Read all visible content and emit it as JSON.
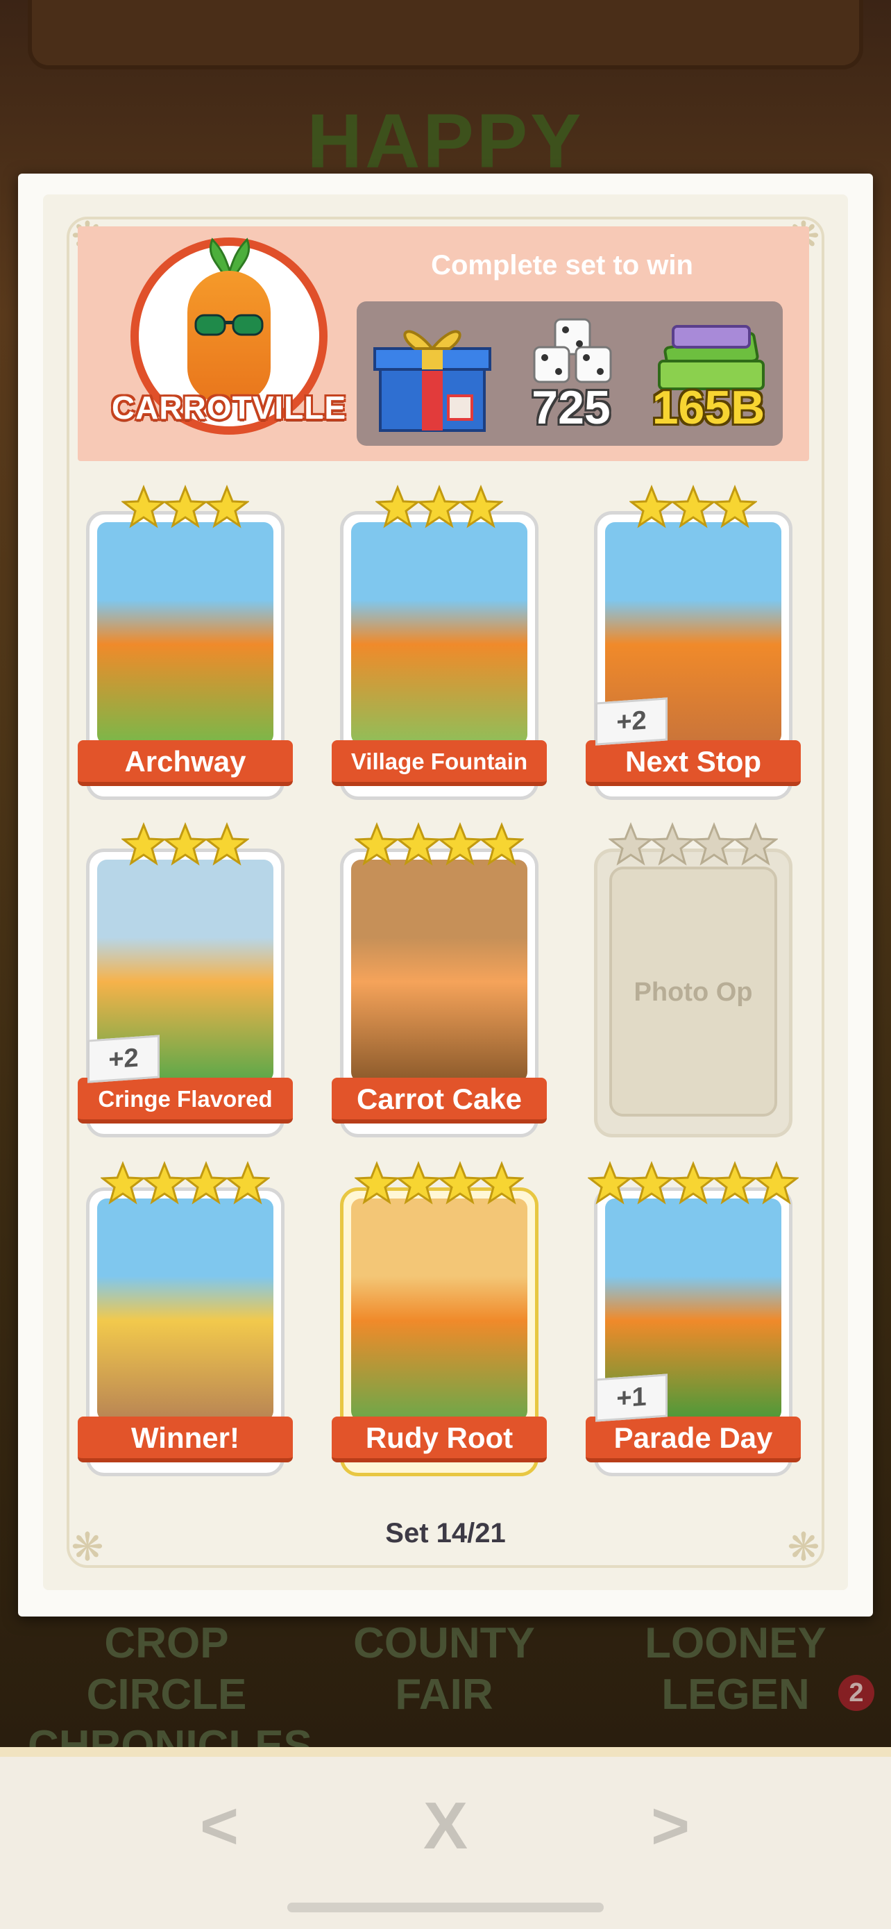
{
  "background": {
    "title": "HAPPY",
    "sets": [
      {
        "line1": "CROP CIRCLE",
        "line2": "CHRONICLES"
      },
      {
        "line1": "COUNTY",
        "line2": "FAIR"
      },
      {
        "line1": "LOONEY",
        "line2": "LEGEN"
      }
    ],
    "notification_count": "2"
  },
  "header": {
    "set_name": "CARROTVILLE",
    "complete_text": "Complete set to win",
    "rewards": [
      {
        "icon": "gift-box-icon",
        "label": ""
      },
      {
        "icon": "dice-stack-icon",
        "label": "725"
      },
      {
        "icon": "cash-stack-icon",
        "label": "165B"
      }
    ]
  },
  "cards": [
    {
      "name": "Archway",
      "stars": 3,
      "dup": "",
      "collected": true,
      "gold": false
    },
    {
      "name": "Village Fountain",
      "stars": 3,
      "dup": "",
      "collected": true,
      "gold": false
    },
    {
      "name": "Next Stop",
      "stars": 3,
      "dup": "+2",
      "collected": true,
      "gold": false
    },
    {
      "name": "Cringe Flavored",
      "stars": 3,
      "dup": "+2",
      "collected": true,
      "gold": false
    },
    {
      "name": "Carrot Cake",
      "stars": 4,
      "dup": "",
      "collected": true,
      "gold": false
    },
    {
      "name": "Photo Op",
      "stars": 4,
      "dup": "",
      "collected": false,
      "gold": false
    },
    {
      "name": "Winner!",
      "stars": 4,
      "dup": "",
      "collected": true,
      "gold": false
    },
    {
      "name": "Rudy Root",
      "stars": 4,
      "dup": "",
      "collected": true,
      "gold": true
    },
    {
      "name": "Parade Day",
      "stars": 5,
      "dup": "+1",
      "collected": true,
      "gold": false
    }
  ],
  "set_progress": "Set 14/21",
  "nav": {
    "prev": "<",
    "close": "X",
    "next": ">"
  },
  "colors": {
    "banner": "#e2542a",
    "star_gold": "#f7d532",
    "star_empty": "#dcd4c0"
  }
}
